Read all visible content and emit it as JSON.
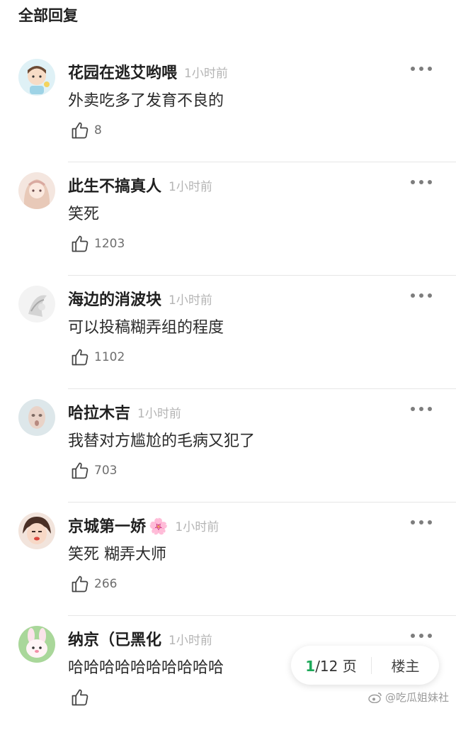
{
  "header": {
    "title": "全部回复"
  },
  "comments": [
    {
      "name": "花园在逃艾哟喂",
      "time": "1小时前",
      "text": "外卖吃多了发育不良的",
      "likes": "8"
    },
    {
      "name": "此生不搞真人",
      "time": "1小时前",
      "text": "笑死",
      "likes": "1203"
    },
    {
      "name": "海边的消波块",
      "time": "1小时前",
      "text": "可以投稿糊弄组的程度",
      "likes": "1102"
    },
    {
      "name": "哈拉木吉",
      "time": "1小时前",
      "text": "我替对方尴尬的毛病又犯了",
      "likes": "703"
    },
    {
      "name": "京城第一娇",
      "name_emoji": "🌸",
      "time": "1小时前",
      "text": "笑死 糊弄大师",
      "likes": "266"
    },
    {
      "name": "纳京（已黑化",
      "time": "1小时前",
      "text": "哈哈哈哈哈哈哈哈哈哈",
      "likes": ""
    }
  ],
  "pager": {
    "current": "1",
    "total": "/12 页",
    "host_label": "楼主"
  },
  "watermark": {
    "text": "@吃瓜姐妹社"
  },
  "colors": {
    "accent": "#1ea95a",
    "time": "#b4b4b4",
    "divider": "#e6e6e6"
  },
  "icons": [
    "thumb-up-icon",
    "more-dots-icon",
    "weibo-icon"
  ]
}
